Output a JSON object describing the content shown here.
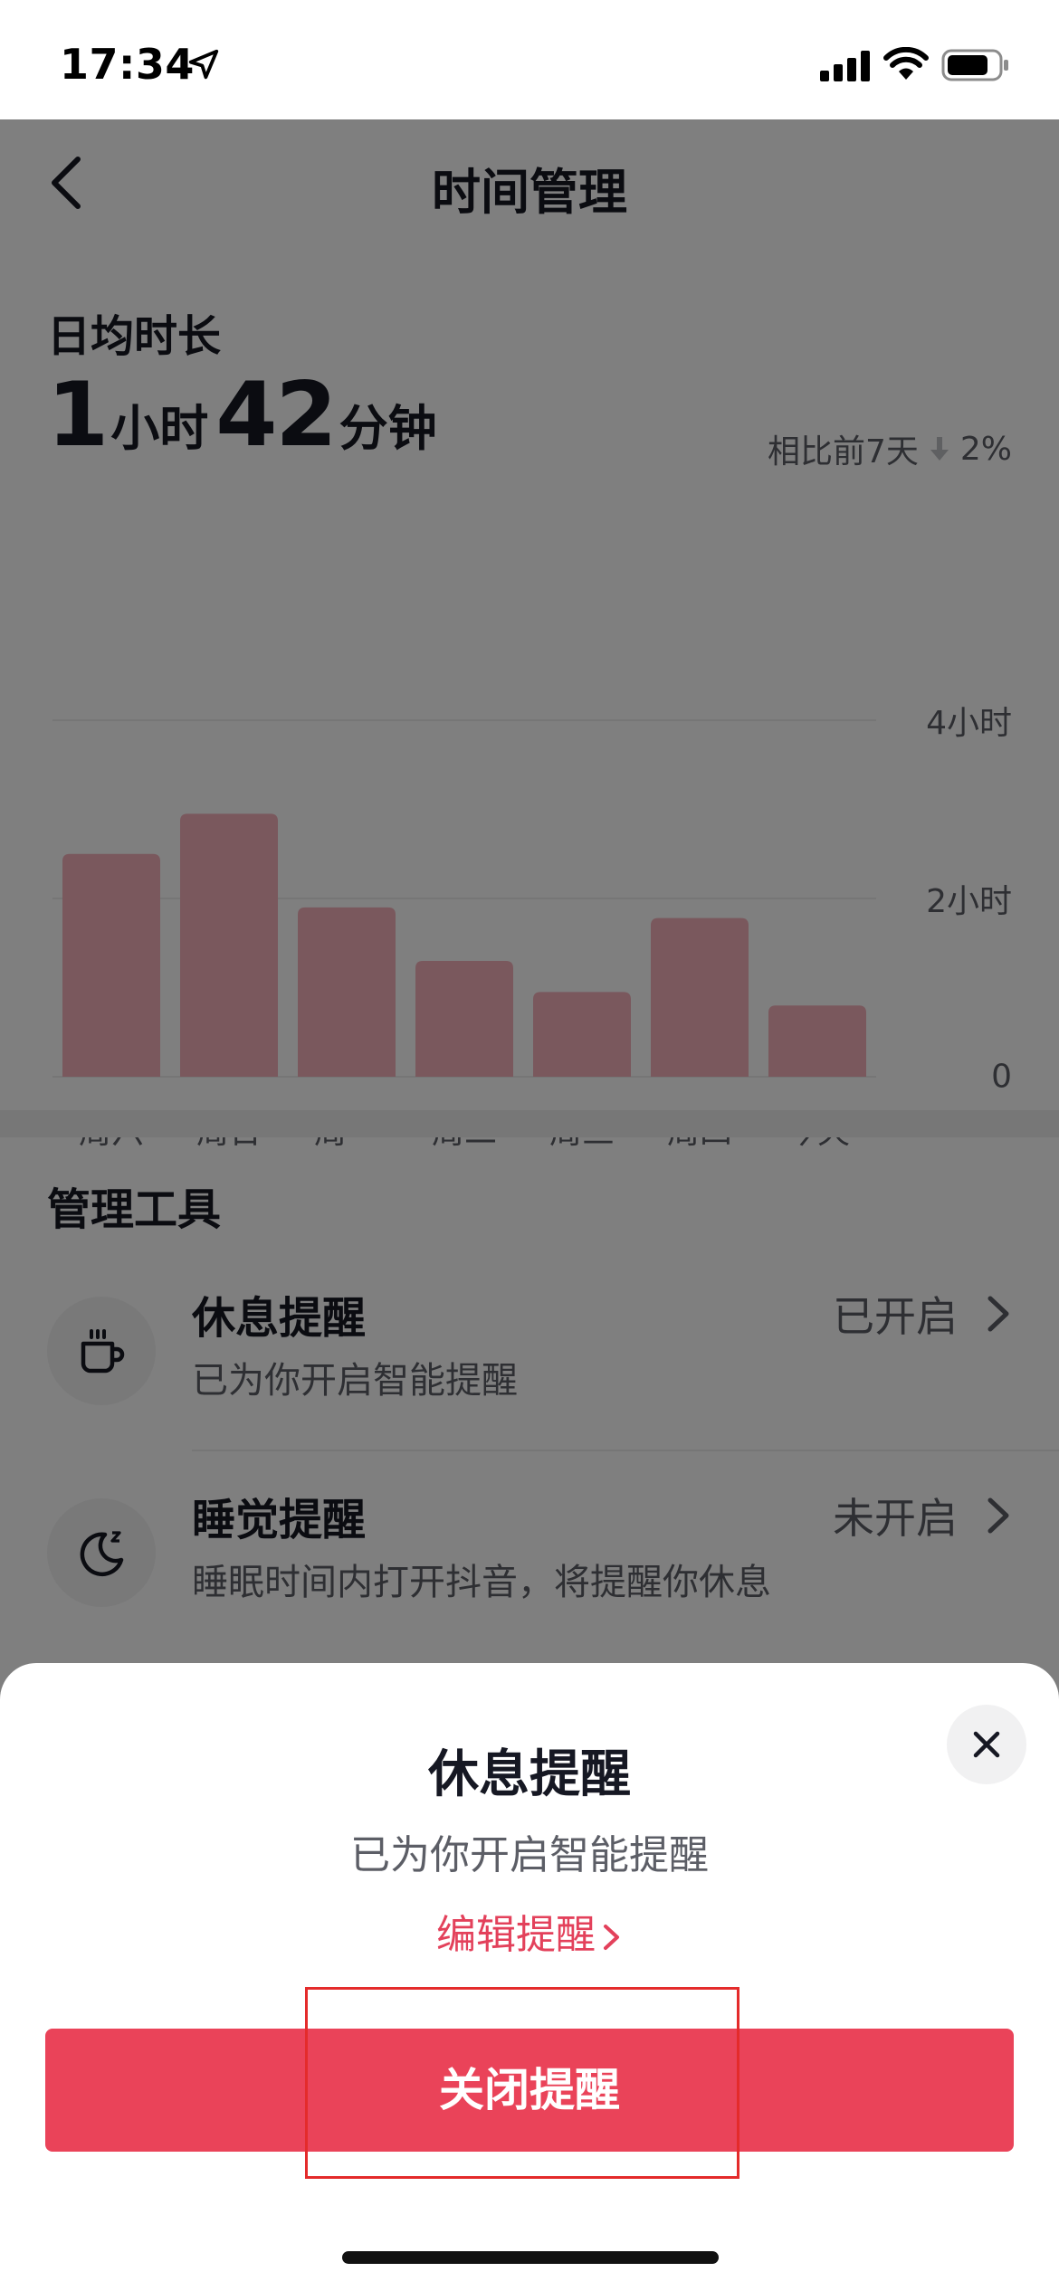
{
  "status_bar": {
    "time": "17:34"
  },
  "header": {
    "title": "时间管理"
  },
  "summary": {
    "label": "日均时长",
    "hours": "1",
    "hours_unit": "小时",
    "minutes": "42",
    "minutes_unit": "分钟",
    "compare_label": "相比前7天",
    "compare_value": "2%",
    "compare_direction": "down"
  },
  "chart_data": {
    "type": "bar",
    "categories": [
      "周六",
      "周日",
      "周一",
      "周二",
      "周三",
      "周四",
      "今天"
    ],
    "values": [
      2.5,
      2.95,
      1.9,
      1.3,
      0.95,
      1.78,
      0.8
    ],
    "unit": "小时",
    "ylim": [
      0,
      4
    ],
    "yticks": [
      "4小时",
      "2小时",
      "0"
    ],
    "grid": true,
    "bar_color": "#f5b1bb"
  },
  "tools": {
    "title": "管理工具",
    "items": [
      {
        "name": "休息提醒",
        "desc": "已为你开启智能提醒",
        "status": "已开启",
        "icon": "cup-icon"
      },
      {
        "name": "睡觉提醒",
        "desc": "睡眠时间内打开抖音，将提醒你休息",
        "status": "未开启",
        "icon": "moon-icon"
      }
    ]
  },
  "sheet": {
    "title": "休息提醒",
    "subtitle": "已为你开启智能提醒",
    "edit_label": "编辑提醒",
    "button_label": "关闭提醒"
  },
  "colors": {
    "accent": "#ea4359",
    "link": "#e3415b",
    "highlight": "#e42b2b"
  }
}
